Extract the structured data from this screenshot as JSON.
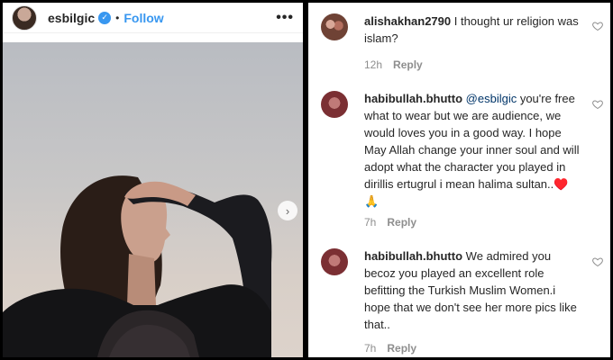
{
  "post": {
    "username": "esbilgic",
    "separator": "•",
    "follow_label": "Follow",
    "more_label": "•••"
  },
  "comments": [
    {
      "username": "alishakhan2790",
      "text": " I thought ur religion was islam?",
      "time": "12h",
      "reply_label": "Reply"
    },
    {
      "username": "habibullah.bhutto",
      "mention": " @esbilgic",
      "text": " you're free what to wear but we are audience, we would loves you in a good way. I hope May Allah change your inner soul and will adopt what the character you played in dirillis ertugrul i mean halima sultan..♥️ 🙏",
      "time": "7h",
      "reply_label": "Reply"
    },
    {
      "username": "habibullah.bhutto",
      "text": " We admired you becoz you played an excellent role befitting the Turkish Muslim Women.i hope that we don't see her more pics like that..",
      "time": "7h",
      "reply_label": "Reply"
    }
  ]
}
